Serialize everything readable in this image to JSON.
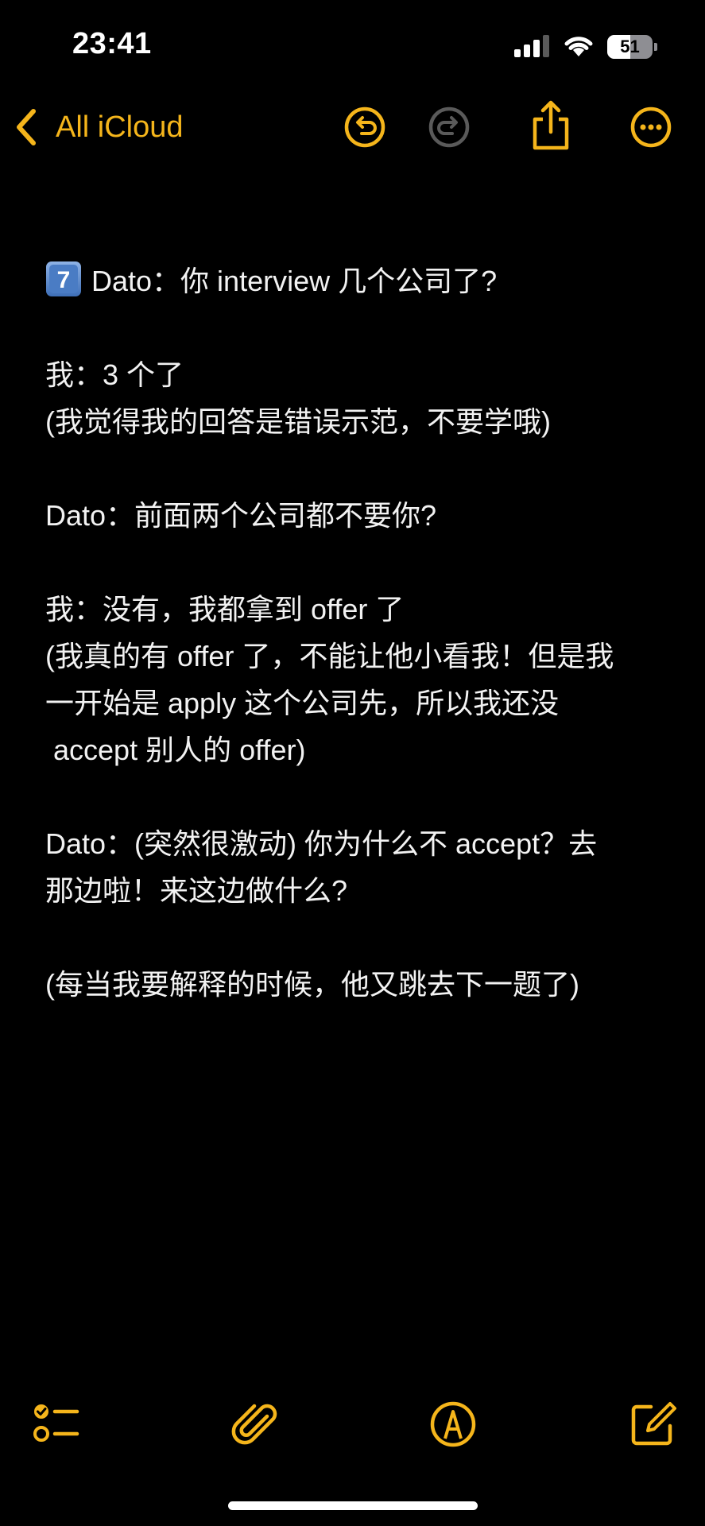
{
  "status_bar": {
    "time": "23:41",
    "battery_level": "51",
    "battery_fraction": 0.51
  },
  "nav": {
    "back_label": "All iCloud",
    "icons": [
      "chevron-left-icon",
      "undo-icon",
      "redo-icon",
      "share-icon",
      "more-icon"
    ]
  },
  "note": {
    "badge": "7",
    "lines": [
      "Dato：你 interview 几个公司了?",
      "",
      "我：3 个了",
      "(我觉得我的回答是错误示范，不要学哦)",
      "",
      "Dato：前面两个公司都不要你?",
      "",
      "我：没有，我都拿到 offer 了",
      "(我真的有 offer 了，不能让他小看我！但是我",
      "一开始是 apply 这个公司先，所以我还没",
      " accept 别人的 offer)",
      "",
      "Dato：(突然很激动) 你为什么不 accept？去",
      "那边啦！来这边做什么?",
      "",
      "(每当我要解释的时候，他又跳去下一题了)"
    ]
  },
  "toolbar": {
    "icons": [
      "checklist-icon",
      "attachment-icon",
      "markup-icon",
      "compose-icon"
    ]
  },
  "colors": {
    "accent": "#f5b51b",
    "background": "#000000",
    "text": "#f2f2f2",
    "disabled": "#5a5a5a"
  }
}
